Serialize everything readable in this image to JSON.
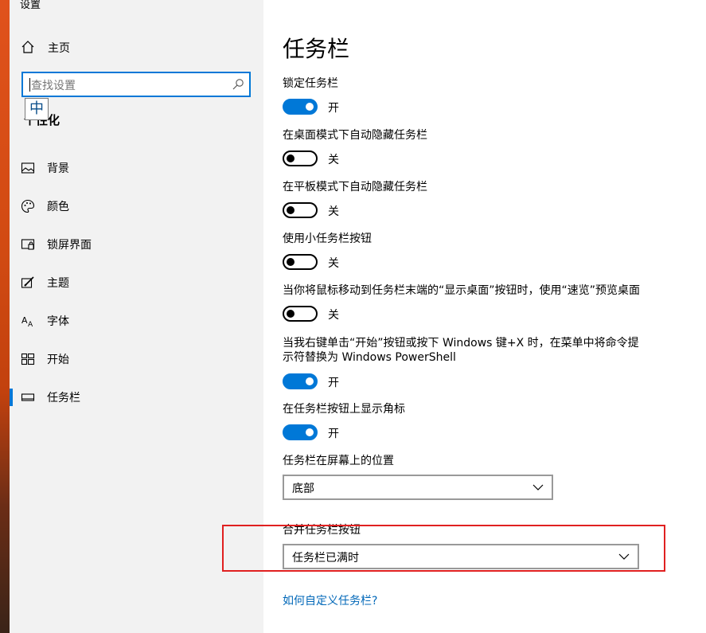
{
  "window": {
    "title": "设置"
  },
  "sidebar": {
    "home_label": "主页",
    "search_placeholder": "查找设置",
    "ime_indicator": "中",
    "section_title": "个性化",
    "items": [
      {
        "label": "背景",
        "icon": "picture-icon"
      },
      {
        "label": "颜色",
        "icon": "palette-icon"
      },
      {
        "label": "锁屏界面",
        "icon": "lock-screen-icon"
      },
      {
        "label": "主题",
        "icon": "theme-brush-icon"
      },
      {
        "label": "字体",
        "icon": "font-icon"
      },
      {
        "label": "开始",
        "icon": "start-tiles-icon"
      },
      {
        "label": "任务栏",
        "icon": "taskbar-icon",
        "selected": true
      }
    ]
  },
  "main": {
    "title": "任务栏",
    "settings": [
      {
        "label": "锁定任务栏",
        "on": true,
        "state": "开"
      },
      {
        "label": "在桌面模式下自动隐藏任务栏",
        "on": false,
        "state": "关"
      },
      {
        "label": "在平板模式下自动隐藏任务栏",
        "on": false,
        "state": "关"
      },
      {
        "label": "使用小任务栏按钮",
        "on": false,
        "state": "关"
      },
      {
        "label": "当你将鼠标移动到任务栏末端的“显示桌面”按钮时，使用“速览”预览桌面",
        "on": false,
        "state": "关"
      },
      {
        "label_line1": "当我右键单击“开始”按钮或按下 Windows 键+X 时，在菜单中将命令提",
        "label_line2": "示符替换为 Windows PowerShell",
        "on": true,
        "state": "开"
      },
      {
        "label": "在任务栏按钮上显示角标",
        "on": true,
        "state": "开"
      }
    ],
    "position": {
      "label": "任务栏在屏幕上的位置",
      "value": "底部"
    },
    "combine": {
      "label": "合并任务栏按钮",
      "value": "任务栏已满时"
    },
    "help_link": "如何自定义任务栏?"
  },
  "colors": {
    "accent": "#0078d7",
    "highlight_box": "#e02020",
    "link": "#0067b8"
  }
}
